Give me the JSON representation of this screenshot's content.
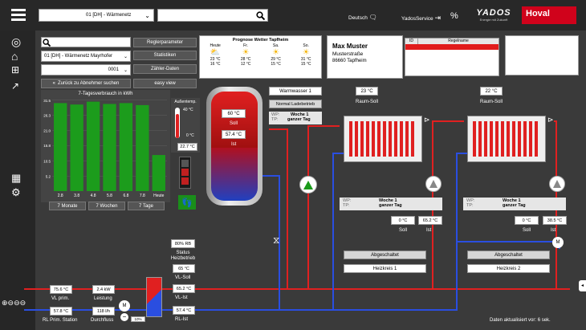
{
  "header": {
    "network_select": "01 [DH] - Wärmenetz",
    "search_value": "",
    "language": "Deutsch",
    "service": "YadosService",
    "percent_icon": "%",
    "brand": "YADOS",
    "brand_sub": "Energie mit Zukunft",
    "hoval": "Hoval"
  },
  "controls": {
    "search_value": "",
    "network2": "01 [DH] - Wärmenetz Mayrhofer",
    "number": "0001",
    "back_label": "Zurück zu Abnehmer suchen",
    "btn_regler": "Reglerparameter",
    "btn_stat": "Statistiken",
    "btn_zaehler": "Zähler-Daten",
    "btn_easy": "easy view"
  },
  "weather": {
    "title": "Prognose Wetter Tapfheim",
    "days": [
      {
        "day": "Heute",
        "max": "23 °C",
        "min": "16 °C"
      },
      {
        "day": "Fr.",
        "max": "28 °C",
        "min": "12 °C"
      },
      {
        "day": "Sa.",
        "max": "29 °C",
        "min": "15 °C"
      },
      {
        "day": "So.",
        "max": "31 °C",
        "min": "15 °C"
      }
    ]
  },
  "customer": {
    "name": "Max Muster",
    "street": "Musterstraße",
    "city": "86660 Tapfheim"
  },
  "alarm_table": {
    "col1": "ID",
    "col2": "Regelname"
  },
  "chart_data": {
    "type": "bar",
    "title": "7-Tagesverbrauch in kWh",
    "categories": [
      "2.8",
      "3.8",
      "4.8",
      "5.8",
      "6.8",
      "7.8",
      "Heute"
    ],
    "values": [
      30.5,
      30.0,
      31.0,
      30.2,
      30.5,
      29.8,
      12.5
    ],
    "yticks": [
      "31.5",
      "26.3",
      "21.0",
      "15.8",
      "10.5",
      "5.2"
    ],
    "ylim": [
      0,
      32
    ],
    "color": "#1c9c1c"
  },
  "chart_tabs": [
    "7 Monate",
    "7 Wochen",
    "7 Tage"
  ],
  "outdoor": {
    "title": "Außentemp.",
    "top": "40 °C",
    "bottom": "0 °C",
    "value": "22.7 °C"
  },
  "tank": {
    "soll": "60 °C",
    "soll_lbl": "Soll",
    "ist": "57.4 °C",
    "ist_lbl": "Ist",
    "ww_label": "Warmwasser 1",
    "mode": "Normal Ladebetrieb",
    "wp_lbl": "WP:",
    "tp_lbl": "TP:",
    "wp": "Woche 1",
    "tp": "ganzer Tag"
  },
  "station": {
    "rb": "80% RB",
    "status_lbl": "Status\nHeizbetrieb",
    "vl_soll": "65 °C",
    "vl_soll_lbl": "VL-Soll",
    "vl_ist": "65.2 °C",
    "vl_ist_lbl": "VL-Ist",
    "rl_ist": "57.4 °C",
    "rl_ist_lbl": "RL-Ist"
  },
  "primary": {
    "vl": "75.6 °C",
    "vl_lbl": "VL prim.",
    "leistung": "2.4 kW",
    "leistung_lbl": "Leistung",
    "rl": "57.8 °C",
    "rl_lbl": "RL Prim. Station",
    "flow": "118 l/h",
    "flow_lbl": "Durchfluss",
    "valve_lbl": "M",
    "valve_pct": "10%"
  },
  "hk1": {
    "raum": "23 °C",
    "raum_lbl": "Raum-Soll",
    "wp_lbl": "WP:",
    "tp_lbl": "TP:",
    "wp": "Woche 1",
    "tp": "ganzer Tag",
    "soll": "0 °C",
    "soll_lbl": "Soll",
    "ist": "65.2 °C",
    "ist_lbl": "Ist",
    "state": "Abgeschaltet",
    "name": "Heizkreis 1"
  },
  "hk2": {
    "raum": "22 °C",
    "raum_lbl": "Raum-Soll",
    "wp_lbl": "WP:",
    "tp_lbl": "TP:",
    "wp": "Woche 1",
    "tp": "ganzer Tag",
    "soll": "0 °C",
    "soll_lbl": "Soll",
    "ist": "38.5 °C",
    "ist_lbl": "Ist",
    "state": "Abgeschaltet",
    "name": "Heizkreis 2"
  },
  "footer": {
    "updated": "Daten aktualisiert vor: 6 sek."
  }
}
